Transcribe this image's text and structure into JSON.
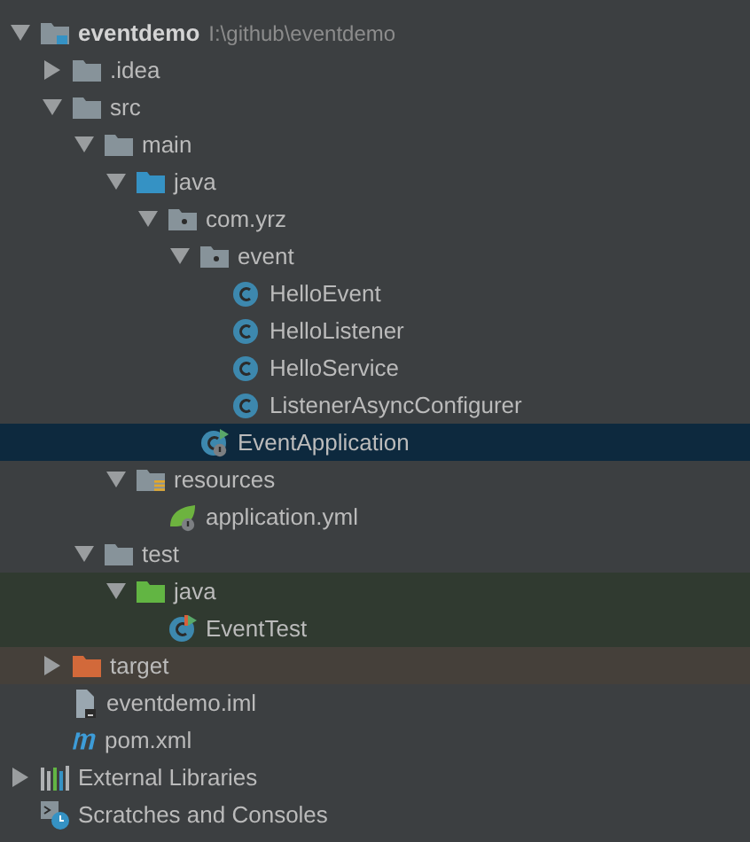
{
  "project_tree": [
    {
      "label": "eventdemo",
      "path": "I:\\github\\eventdemo",
      "kind": "module",
      "expanded": true,
      "selected": false,
      "children": [
        {
          "label": ".idea",
          "kind": "folder",
          "expanded": false,
          "selected": false
        },
        {
          "label": "src",
          "kind": "folder",
          "expanded": true,
          "selected": false,
          "children": [
            {
              "label": "main",
              "kind": "folder",
              "expanded": true,
              "selected": false,
              "children": [
                {
                  "label": "java",
                  "kind": "source-folder",
                  "expanded": true,
                  "selected": false,
                  "children": [
                    {
                      "label": "com.yrz",
                      "kind": "package",
                      "expanded": true,
                      "selected": false,
                      "children": [
                        {
                          "label": "event",
                          "kind": "package",
                          "expanded": true,
                          "selected": false,
                          "children": [
                            {
                              "label": "HelloEvent",
                              "kind": "class",
                              "selected": false
                            },
                            {
                              "label": "HelloListener",
                              "kind": "class",
                              "selected": false
                            },
                            {
                              "label": "HelloService",
                              "kind": "class",
                              "selected": false
                            },
                            {
                              "label": "ListenerAsyncConfigurer",
                              "kind": "class",
                              "selected": false
                            }
                          ]
                        },
                        {
                          "label": "EventApplication",
                          "kind": "spring-app",
                          "selected": true
                        }
                      ]
                    }
                  ]
                },
                {
                  "label": "resources",
                  "kind": "resources-folder",
                  "expanded": true,
                  "selected": false,
                  "children": [
                    {
                      "label": "application.yml",
                      "kind": "spring-config",
                      "selected": false
                    }
                  ]
                }
              ]
            },
            {
              "label": "test",
              "kind": "folder",
              "expanded": true,
              "selected": false,
              "children": [
                {
                  "label": "java",
                  "kind": "test-folder",
                  "expanded": true,
                  "selected": false,
                  "children": [
                    {
                      "label": "EventTest",
                      "kind": "test-class",
                      "selected": false
                    }
                  ]
                }
              ]
            }
          ]
        },
        {
          "label": "target",
          "kind": "excluded-folder",
          "expanded": false,
          "selected": false
        },
        {
          "label": "eventdemo.iml",
          "kind": "iml-file",
          "selected": false
        },
        {
          "label": "pom.xml",
          "kind": "maven-file",
          "selected": false
        }
      ]
    },
    {
      "label": "External Libraries",
      "kind": "libraries",
      "expanded": false,
      "selected": false
    },
    {
      "label": "Scratches and Consoles",
      "kind": "scratches",
      "selected": false
    }
  ]
}
